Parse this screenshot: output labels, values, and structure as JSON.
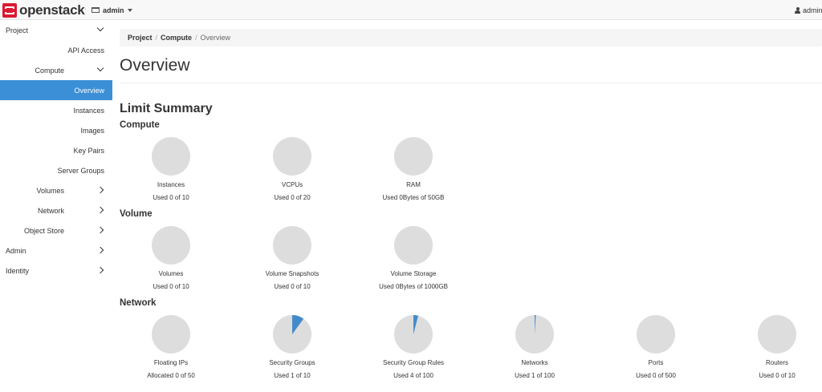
{
  "header": {
    "brand": "openstack",
    "brand_mark": ".",
    "project": "admin",
    "user": "admin"
  },
  "sidebar": {
    "items": [
      {
        "label": "Project",
        "level": 0,
        "chevron": "down"
      },
      {
        "label": "API Access",
        "level": 2
      },
      {
        "label": "Compute",
        "level": 1,
        "chevron": "down"
      },
      {
        "label": "Overview",
        "level": 2,
        "active": true
      },
      {
        "label": "Instances",
        "level": 2
      },
      {
        "label": "Images",
        "level": 2
      },
      {
        "label": "Key Pairs",
        "level": 2
      },
      {
        "label": "Server Groups",
        "level": 2
      },
      {
        "label": "Volumes",
        "level": 1,
        "chevron": "right"
      },
      {
        "label": "Network",
        "level": 1,
        "chevron": "right"
      },
      {
        "label": "Object Store",
        "level": 1,
        "chevron": "right"
      },
      {
        "label": "Admin",
        "level": 0,
        "chevron": "right"
      },
      {
        "label": "Identity",
        "level": 0,
        "chevron": "right"
      }
    ]
  },
  "breadcrumb": [
    "Project",
    "Compute",
    "Overview"
  ],
  "page_title": "Overview",
  "limit_summary": {
    "title": "Limit Summary",
    "sections": [
      {
        "name": "Compute",
        "charts": [
          {
            "name": "Instances",
            "usage": "Used 0 of 10",
            "used": 0,
            "total": 10
          },
          {
            "name": "VCPUs",
            "usage": "Used 0 of 20",
            "used": 0,
            "total": 20
          },
          {
            "name": "RAM",
            "usage": "Used 0Bytes of 50GB",
            "used": 0,
            "total": 50
          }
        ]
      },
      {
        "name": "Volume",
        "charts": [
          {
            "name": "Volumes",
            "usage": "Used 0 of 10",
            "used": 0,
            "total": 10
          },
          {
            "name": "Volume Snapshots",
            "usage": "Used 0 of 10",
            "used": 0,
            "total": 10
          },
          {
            "name": "Volume Storage",
            "usage": "Used 0Bytes of 1000GB",
            "used": 0,
            "total": 1000
          }
        ]
      },
      {
        "name": "Network",
        "charts": [
          {
            "name": "Floating IPs",
            "usage": "Allocated 0 of 50",
            "used": 0,
            "total": 50
          },
          {
            "name": "Security Groups",
            "usage": "Used 1 of 10",
            "used": 1,
            "total": 10
          },
          {
            "name": "Security Group Rules",
            "usage": "Used 4 of 100",
            "used": 4,
            "total": 100
          },
          {
            "name": "Networks",
            "usage": "Used 1 of 100",
            "used": 1,
            "total": 100
          },
          {
            "name": "Ports",
            "usage": "Used 0 of 500",
            "used": 0,
            "total": 500
          },
          {
            "name": "Routers",
            "usage": "Used 0 of 10",
            "used": 0,
            "total": 10
          }
        ]
      }
    ]
  },
  "colors": {
    "accent": "#3b8fd6",
    "pie_empty": "#dddddd",
    "pie_fill": "#428bca",
    "brand_red": "#da1a32"
  }
}
